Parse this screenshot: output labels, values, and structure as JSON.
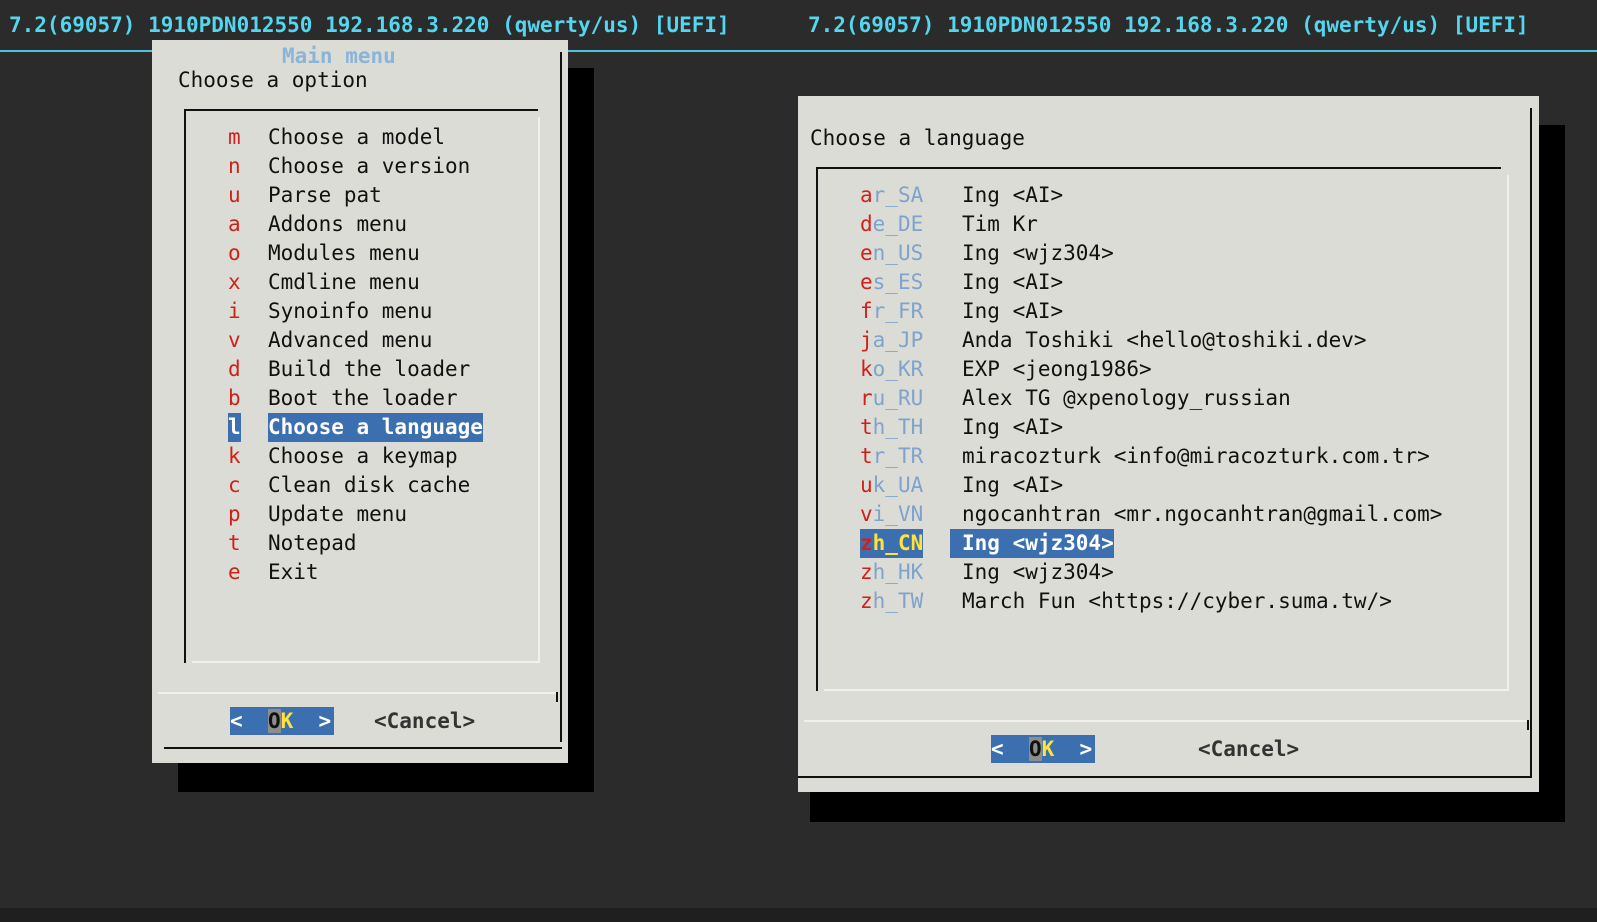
{
  "header": {
    "left_status": "7.2(69057) 1910PDN012550 192.168.3.220 (qwerty/us) [UEFI]",
    "right_status": "7.2(69057) 1910PDN012550 192.168.3.220 (qwerty/us) [UEFI]"
  },
  "main_menu": {
    "title": "Main menu",
    "prompt": "Choose a option",
    "selected_index": 10,
    "items": [
      {
        "key": "m",
        "label": "Choose a model"
      },
      {
        "key": "n",
        "label": "Choose a version"
      },
      {
        "key": "u",
        "label": "Parse pat"
      },
      {
        "key": "a",
        "label": "Addons menu"
      },
      {
        "key": "o",
        "label": "Modules menu"
      },
      {
        "key": "x",
        "label": "Cmdline menu"
      },
      {
        "key": "i",
        "label": "Synoinfo menu"
      },
      {
        "key": "v",
        "label": "Advanced menu"
      },
      {
        "key": "d",
        "label": "Build the loader"
      },
      {
        "key": "b",
        "label": "Boot the loader"
      },
      {
        "key": "l",
        "label": "Choose a language"
      },
      {
        "key": "k",
        "label": "Choose a keymap"
      },
      {
        "key": "c",
        "label": "Clean disk cache"
      },
      {
        "key": "p",
        "label": "Update menu"
      },
      {
        "key": "t",
        "label": "Notepad"
      },
      {
        "key": "e",
        "label": "Exit"
      }
    ],
    "ok": {
      "left": "<  ",
      "o": "O",
      "k": "K",
      "right": "  >"
    },
    "cancel_label": "<Cancel>"
  },
  "language_menu": {
    "prompt": "Choose a language",
    "selected_index": 12,
    "items": [
      {
        "hk": "a",
        "rest": "r_SA",
        "label": "Ing <AI>"
      },
      {
        "hk": "d",
        "rest": "e_DE",
        "label": "Tim Kr"
      },
      {
        "hk": "e",
        "rest": "n_US",
        "label": "Ing <wjz304>"
      },
      {
        "hk": "e",
        "rest": "s_ES",
        "label": "Ing <AI>"
      },
      {
        "hk": "f",
        "rest": "r_FR",
        "label": "Ing <AI>"
      },
      {
        "hk": "j",
        "rest": "a_JP",
        "label": "Anda Toshiki <hello@toshiki.dev>"
      },
      {
        "hk": "k",
        "rest": "o_KR",
        "label": "EXP <jeong1986>"
      },
      {
        "hk": "r",
        "rest": "u_RU",
        "label": "Alex TG @xpenology_russian"
      },
      {
        "hk": "t",
        "rest": "h_TH",
        "label": "Ing <AI>"
      },
      {
        "hk": "t",
        "rest": "r_TR",
        "label": "miracozturk <info@miracozturk.com.tr>"
      },
      {
        "hk": "u",
        "rest": "k_UA",
        "label": "Ing <AI>"
      },
      {
        "hk": "v",
        "rest": "i_VN",
        "label": "ngocanhtran <mr.ngocanhtran@gmail.com>"
      },
      {
        "hk": "z",
        "rest": "h_CN",
        "label": "Ing <wjz304>"
      },
      {
        "hk": "z",
        "rest": "h_HK",
        "label": "Ing <wjz304>"
      },
      {
        "hk": "z",
        "rest": "h_TW",
        "label": "March Fun <https://cyber.suma.tw/>"
      }
    ],
    "ok": {
      "left": "<  ",
      "o": "O",
      "k": "K",
      "right": "  >"
    },
    "cancel_label": "<Cancel>"
  },
  "colors": {
    "background": "#2b2b2b",
    "dialog": "#dcdcd6",
    "selection": "#3b6fb0",
    "hotkey": "#d0201a",
    "tag": "#7ea3cc",
    "status_text": "#55d6ef"
  }
}
